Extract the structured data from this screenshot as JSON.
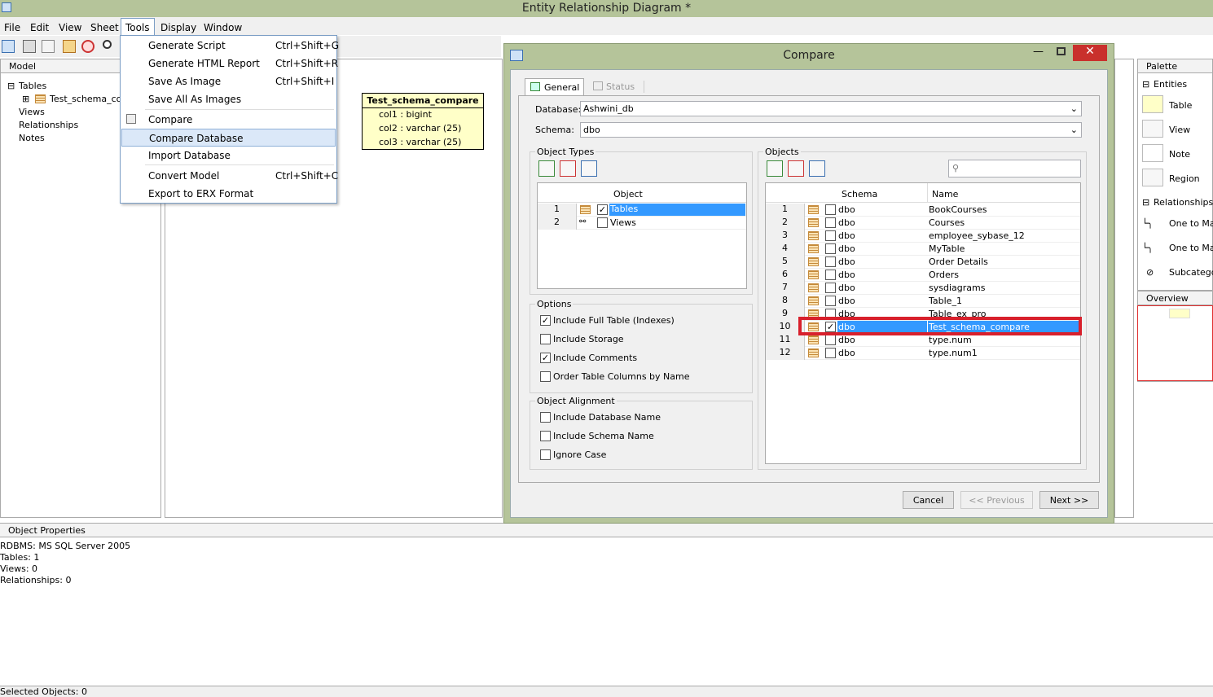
{
  "window": {
    "title": "Entity Relationship Diagram *"
  },
  "menu": [
    "File",
    "Edit",
    "View",
    "Sheet",
    "Tools",
    "Display",
    "Window"
  ],
  "tools_menu": [
    {
      "label": "Generate Script",
      "shortcut": "Ctrl+Shift+G"
    },
    {
      "label": "Generate HTML Report",
      "shortcut": "Ctrl+Shift+R"
    },
    {
      "label": "Save As Image",
      "shortcut": "Ctrl+Shift+I"
    },
    {
      "label": "Save All As Images",
      "shortcut": ""
    },
    {
      "label": "Compare",
      "shortcut": ""
    },
    {
      "label": "Compare Database",
      "shortcut": ""
    },
    {
      "label": "Import Database",
      "shortcut": ""
    },
    {
      "label": "Convert Model",
      "shortcut": "Ctrl+Shift+C"
    },
    {
      "label": "Export to ERX Format",
      "shortcut": ""
    }
  ],
  "model_panel": {
    "header": "Model",
    "tables": "Tables",
    "table_item": "Test_schema_com",
    "views": "Views",
    "relationships": "Relationships",
    "notes": "Notes"
  },
  "entity": {
    "title": "Test_schema_compare",
    "columns": [
      "col1 : bigint",
      "col2 : varchar (25)",
      "col3 : varchar (25)"
    ]
  },
  "palette": {
    "header": "Palette",
    "entities": "Entities",
    "table": "Table",
    "view": "View",
    "note": "Note",
    "region": "Region",
    "relationships": "Relationships",
    "one_to_many_1": "One to Mar",
    "one_to_many_2": "One to Mar",
    "subcategory": "Subcategor",
    "overview": "Overview"
  },
  "object_properties": {
    "header": "Object Properties",
    "lines": [
      "RDBMS: MS SQL Server 2005",
      "Tables: 1",
      "Views: 0",
      "Relationships: 0"
    ]
  },
  "statusbar": {
    "text": "Selected Objects: 0"
  },
  "dialog": {
    "title": "Compare",
    "tabs": {
      "general": "General",
      "status": "Status"
    },
    "database_label": "Database:",
    "database_value": "Ashwini_db",
    "schema_label": "Schema:",
    "schema_value": "dbo",
    "object_types": {
      "group": "Object Types",
      "column": "Object",
      "rows": [
        {
          "n": "1",
          "label": "Tables",
          "checked": true
        },
        {
          "n": "2",
          "label": "Views",
          "checked": false
        }
      ]
    },
    "options": {
      "group": "Options",
      "items": [
        {
          "label": "Include Full Table (Indexes)",
          "checked": true
        },
        {
          "label": "Include Storage",
          "checked": false
        },
        {
          "label": "Include Comments",
          "checked": true
        },
        {
          "label": "Order Table Columns by Name",
          "checked": false
        }
      ]
    },
    "alignment": {
      "group": "Object Alignment",
      "items": [
        {
          "label": "Include Database Name",
          "checked": false
        },
        {
          "label": "Include Schema Name",
          "checked": false
        },
        {
          "label": "Ignore Case",
          "checked": false
        }
      ]
    },
    "objects": {
      "group": "Objects",
      "col_schema": "Schema",
      "col_name": "Name",
      "rows": [
        {
          "n": "1",
          "schema": "dbo",
          "name": "BookCourses",
          "checked": false
        },
        {
          "n": "2",
          "schema": "dbo",
          "name": "Courses",
          "checked": false
        },
        {
          "n": "3",
          "schema": "dbo",
          "name": "employee_sybase_12",
          "checked": false
        },
        {
          "n": "4",
          "schema": "dbo",
          "name": "MyTable",
          "checked": false
        },
        {
          "n": "5",
          "schema": "dbo",
          "name": "Order Details",
          "checked": false
        },
        {
          "n": "6",
          "schema": "dbo",
          "name": "Orders",
          "checked": false
        },
        {
          "n": "7",
          "schema": "dbo",
          "name": "sysdiagrams",
          "checked": false
        },
        {
          "n": "8",
          "schema": "dbo",
          "name": "Table_1",
          "checked": false
        },
        {
          "n": "9",
          "schema": "dbo",
          "name": "Table_ex_pro",
          "checked": false
        },
        {
          "n": "10",
          "schema": "dbo",
          "name": "Test_schema_compare",
          "checked": true
        },
        {
          "n": "11",
          "schema": "dbo",
          "name": "type.num",
          "checked": false
        },
        {
          "n": "12",
          "schema": "dbo",
          "name": "type.num1",
          "checked": false
        }
      ]
    },
    "buttons": {
      "cancel": "Cancel",
      "previous": "<< Previous",
      "next": "Next >>"
    }
  }
}
